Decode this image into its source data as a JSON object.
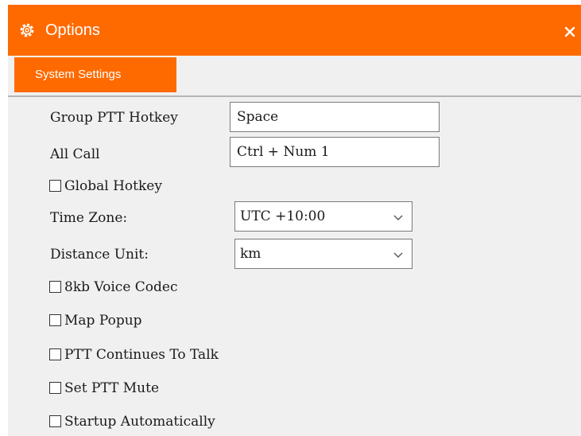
{
  "window": {
    "title": "Options",
    "title_icon": "gear-icon",
    "close_icon": "close-icon",
    "accent_color": "#ff6a00"
  },
  "tabs": [
    {
      "label": "System Settings",
      "active": true
    }
  ],
  "settings": {
    "group_ptt_hotkey": {
      "label": "Group PTT Hotkey",
      "value": "Space"
    },
    "all_call": {
      "label": "All Call",
      "value": "Ctrl + Num 1"
    },
    "global_hotkey": {
      "label": "Global Hotkey",
      "checked": false
    },
    "time_zone": {
      "label": "Time Zone:",
      "value": "UTC +10:00"
    },
    "distance_unit": {
      "label": "Distance Unit:",
      "value": "km"
    },
    "voice_codec_8kb": {
      "label": "8kb Voice Codec",
      "checked": false
    },
    "map_popup": {
      "label": "Map Popup",
      "checked": false
    },
    "ptt_continues": {
      "label": "PTT Continues To Talk",
      "checked": false
    },
    "set_ptt_mute": {
      "label": "Set PTT Mute",
      "checked": false
    },
    "startup_auto": {
      "label": "Startup Automatically",
      "checked": false
    }
  }
}
